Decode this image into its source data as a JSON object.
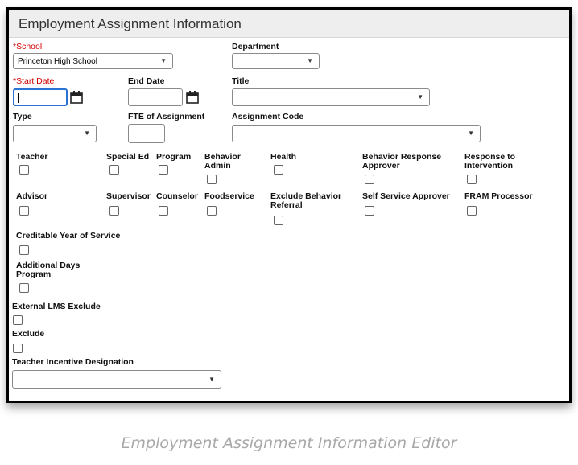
{
  "panel": {
    "title": "Employment Assignment Information"
  },
  "fields": {
    "school": {
      "label": "School",
      "value": "Princeton High School"
    },
    "department": {
      "label": "Department",
      "value": ""
    },
    "start_date": {
      "label": "Start Date",
      "value": ""
    },
    "end_date": {
      "label": "End Date",
      "value": ""
    },
    "title": {
      "label": "Title",
      "value": ""
    },
    "type": {
      "label": "Type",
      "value": ""
    },
    "fte": {
      "label": "FTE of Assignment",
      "value": ""
    },
    "assignment_code": {
      "label": "Assignment Code",
      "value": ""
    },
    "teacher_incentive": {
      "label": "Teacher Incentive Designation",
      "value": ""
    }
  },
  "required_marker": "*",
  "checkboxes_row1": [
    "Teacher",
    "Special Ed",
    "Program",
    "Behavior Admin",
    "Health",
    "Behavior Response Approver",
    "Response to Intervention"
  ],
  "checkboxes_row2": [
    "Advisor",
    "Supervisor",
    "Counselor",
    "Foodservice",
    "Exclude Behavior Referral",
    "Self Service Approver",
    "FRAM Processor"
  ],
  "checkboxes_extra": [
    "Creditable Year of Service",
    "Additional Days Program",
    "External LMS Exclude",
    "Exclude"
  ],
  "caption": "Employment Assignment Information Editor"
}
